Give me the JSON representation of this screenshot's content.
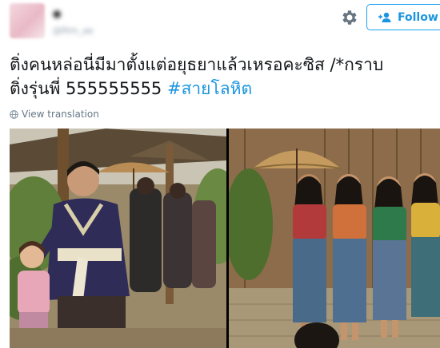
{
  "author": {
    "name": "●",
    "handle": "@film_ae"
  },
  "follow": {
    "label": "Follow"
  },
  "tweet": {
    "line1": "ติ่งคนหล่อนี่มีมาตั้งแต่อยุธยาแล้วเหรอคะซิส /*กราบ",
    "line2_text": "ติ่งรุ่นพี่ 555555555 ",
    "hashtag": "#สายโลหิต"
  },
  "translate": {
    "label": "View translation"
  },
  "colors": {
    "accent": "#1da1f2",
    "link": "#1b95e0",
    "text": "#14171a",
    "muted": "#657786"
  },
  "icons": {
    "gear": "gear-icon",
    "follow": "add-user-icon",
    "translate": "globe-icon"
  },
  "media": [
    {
      "name": "photo-left"
    },
    {
      "name": "photo-right"
    }
  ]
}
